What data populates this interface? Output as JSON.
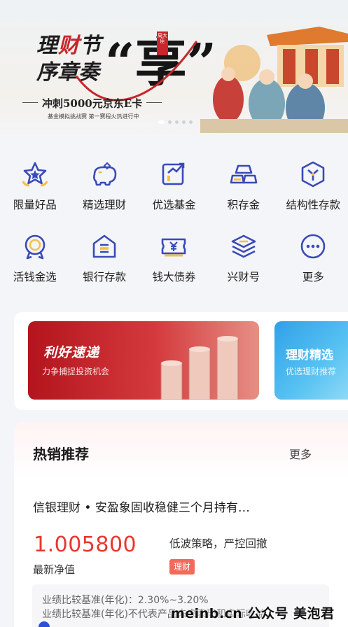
{
  "banner": {
    "title_part1": "理",
    "title_part1_red": "财",
    "title_part1_end": "节",
    "title_line2": "序章奏",
    "big_char": "“享”",
    "seal_text": "周大臣",
    "subtitle": "冲刺5000元京东E卡",
    "tiny_text": "基金模拟挑战赛 第一赛程火热进行中",
    "dots": 5,
    "active_dot": 0,
    "accent_red": "#c8262a"
  },
  "grid": {
    "items": [
      {
        "label": "限量好品",
        "icon": "star-badge-icon"
      },
      {
        "label": "精选理财",
        "icon": "piggy-bank-icon"
      },
      {
        "label": "优选基金",
        "icon": "rising-chart-icon"
      },
      {
        "label": "积存金",
        "icon": "gold-bars-icon"
      },
      {
        "label": "结构性存款",
        "icon": "shield-y-icon"
      },
      {
        "label": "活钱金选",
        "icon": "coin-medal-icon"
      },
      {
        "label": "银行存款",
        "icon": "bank-house-icon"
      },
      {
        "label": "钱大债券",
        "icon": "yen-ticket-icon"
      },
      {
        "label": "兴财号",
        "icon": "layers-icon"
      },
      {
        "label": "更多",
        "icon": "more-dots-icon"
      }
    ],
    "icon_color": "#3a4ab8",
    "icon_accent": "#f2c04a"
  },
  "promo": {
    "main_title": "利好速递",
    "main_subtitle": "力争捕捉投资机会",
    "second_title": "理财精选",
    "second_subtitle": "优选理财推荐"
  },
  "hot": {
    "title": "热销推荐",
    "more": "更多",
    "product": {
      "name": "信银理财 • 安盈象固收稳健三个月持有…",
      "nav": "1.005800",
      "nav_label": "最新净值",
      "strategy": "低波策略，严控回撤",
      "tag": "理财",
      "benchmark_line1": "业绩比较基准(年化)：2.30%~3.20%",
      "benchmark_line2": "业绩比较基准(年化)不代表产品未来表现和实际收益"
    },
    "nav_color": "#e8372f"
  },
  "watermark": "meinb.cn 公众号 美泡君"
}
